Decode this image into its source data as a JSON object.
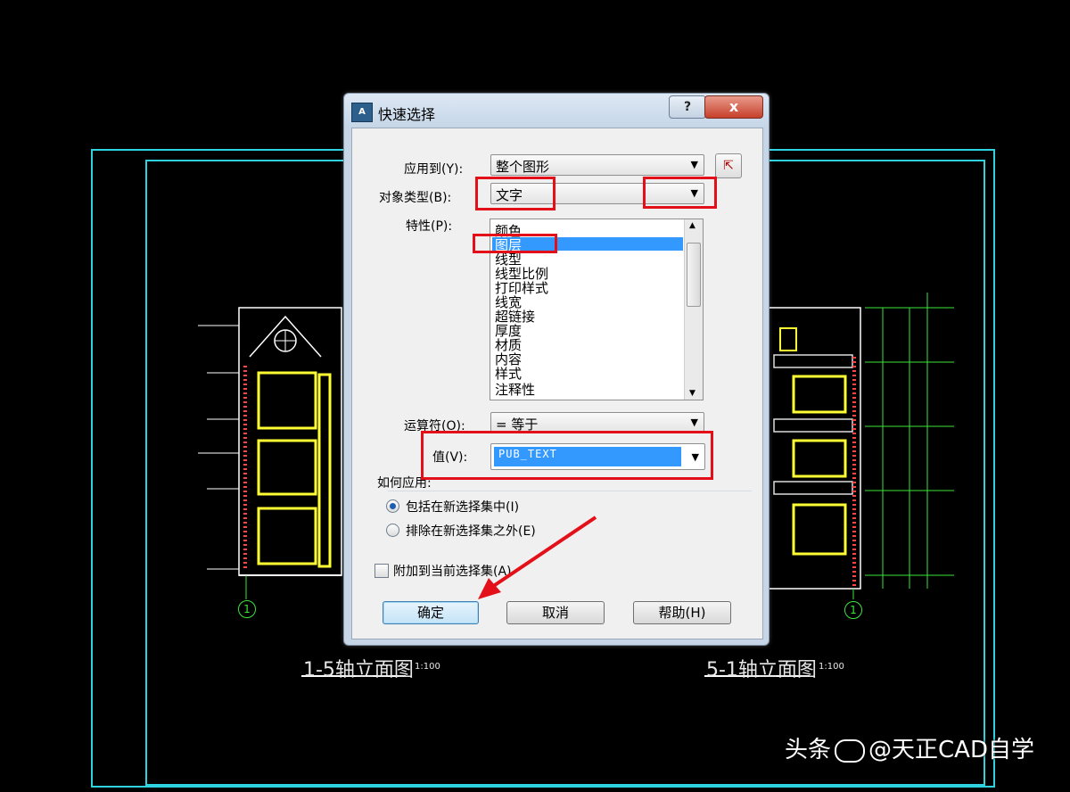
{
  "dialog": {
    "title": "快速选择",
    "help_label": "?",
    "close_label": "x",
    "apply_to": {
      "label": "应用到(Y):",
      "value": "整个图形"
    },
    "object_type": {
      "label": "对象类型(B):",
      "value": "文字"
    },
    "properties": {
      "label": "特性(P):",
      "items": [
        "颜色",
        "图层",
        "线型",
        "线型比例",
        "打印样式",
        "线宽",
        "超链接",
        "厚度",
        "材质",
        "内容",
        "样式",
        "注释性"
      ],
      "selected_index": 1
    },
    "operator": {
      "label": "运算符(O):",
      "value": "= 等于"
    },
    "value": {
      "label": "值(V):",
      "value": "PUB_TEXT"
    },
    "how_to_apply": {
      "label": "如何应用:",
      "include": "包括在新选择集中(I)",
      "exclude": "排除在新选择集之外(E)"
    },
    "append": {
      "label": "附加到当前选择集(A)",
      "checked": false
    },
    "buttons": {
      "ok": "确定",
      "cancel": "取消",
      "help": "帮助(H)"
    }
  },
  "cad": {
    "left_title": "1-5轴立面图",
    "left_scale": "1:100",
    "right_title": "5-1轴立面图",
    "right_scale": "1:100",
    "axis_label": "1"
  },
  "watermark": {
    "prefix": "头条",
    "handle": "@天正CAD自学"
  },
  "colors": {
    "accent_red": "#e3101a",
    "selection_blue": "#3399ff",
    "cad_cyan": "#2fd3e0"
  }
}
